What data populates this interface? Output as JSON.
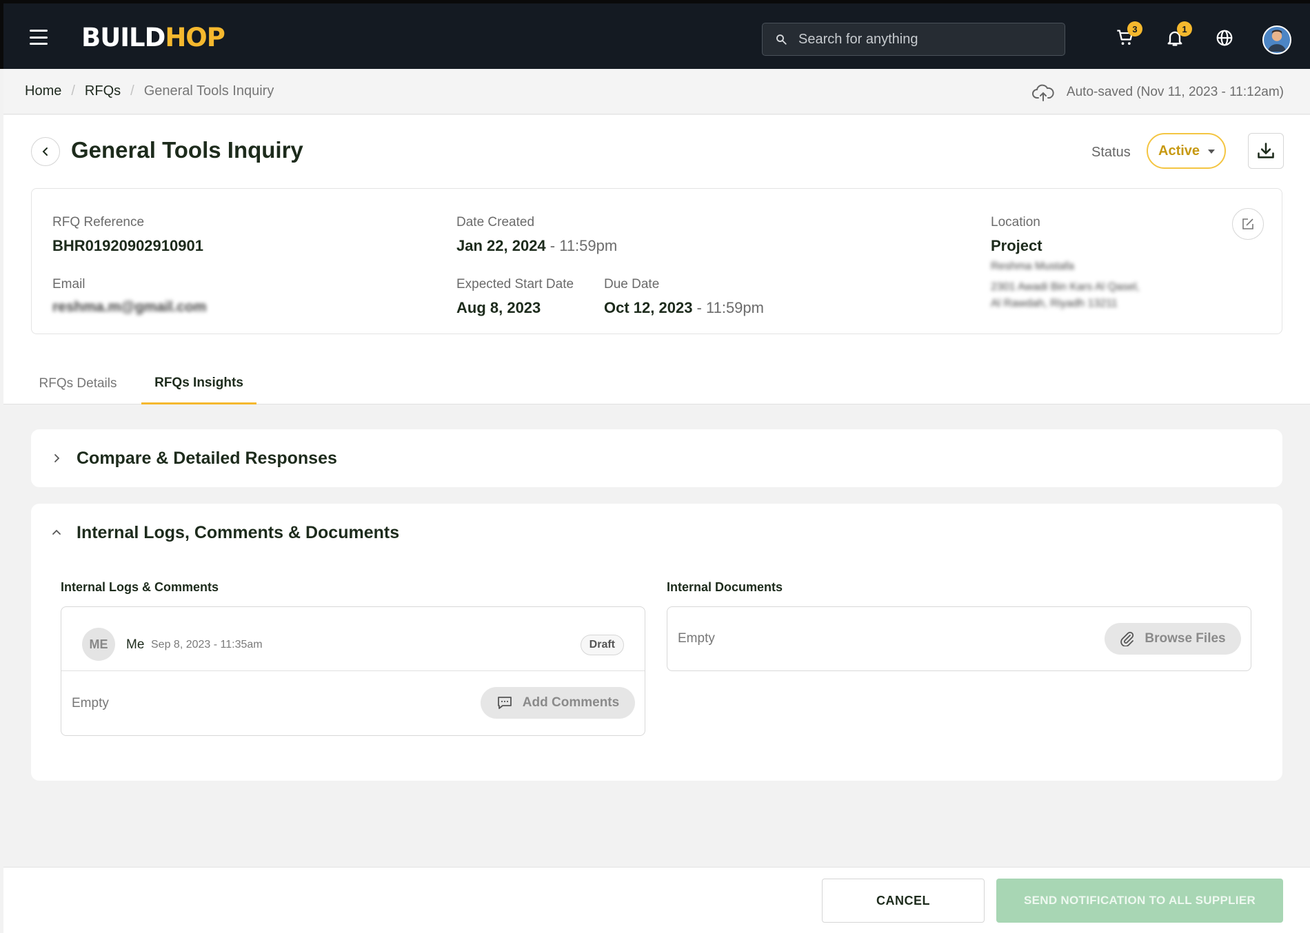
{
  "topbar": {
    "logo_main": "BUILD",
    "logo_accent": "HOP",
    "search_placeholder": "Search for anything",
    "cart_count": "3",
    "notification_count": "1",
    "accent_color": "#f5b82e"
  },
  "breadcrumb": {
    "items": [
      "Home",
      "RFQs"
    ],
    "current": "General Tools Inquiry",
    "autosave_text": "Auto-saved (Nov 11, 2023 - 11:12am)"
  },
  "header": {
    "title": "General Tools Inquiry",
    "status_label": "Status",
    "status_value": "Active"
  },
  "info": {
    "rfq_reference_label": "RFQ Reference",
    "rfq_reference_value": "BHR01920902910901",
    "email_label": "Email",
    "email_value": "reshma.m@gmail.com",
    "date_created_label": "Date Created",
    "date_created_value": "Jan 22, 2024",
    "date_created_time": " - 11:59pm",
    "expected_start_label": "Expected Start Date",
    "expected_start_value": "Aug 8, 2023",
    "due_date_label": "Due Date",
    "due_date_value": "Oct 12, 2023",
    "due_date_time": " - 11:59pm",
    "location_label": "Location",
    "location_value": "Project",
    "location_contact": "Reshma Mustafa",
    "location_address_1": "2301 Awadi Bin Kars Al Qasel,",
    "location_address_2": "Al Rawdah, Riyadh 13211"
  },
  "tabs": [
    {
      "label": "RFQs Details",
      "active": false
    },
    {
      "label": "RFQs Insights",
      "active": true
    }
  ],
  "accordions": {
    "compare_title": "Compare & Detailed Responses",
    "internal_title": "Internal Logs, Comments & Documents"
  },
  "logs": {
    "label": "Internal Logs & Comments",
    "avatar_initials": "ME",
    "author": "Me",
    "date": "Sep 8, 2023 - 11:35am",
    "draft": "Draft",
    "empty": "Empty",
    "add_button": "Add Comments"
  },
  "documents": {
    "label": "Internal Documents",
    "empty": "Empty",
    "browse_button": "Browse Files"
  },
  "footer": {
    "cancel": "CANCEL",
    "send": "SEND NOTIFICATION TO ALL SUPPLIER"
  }
}
